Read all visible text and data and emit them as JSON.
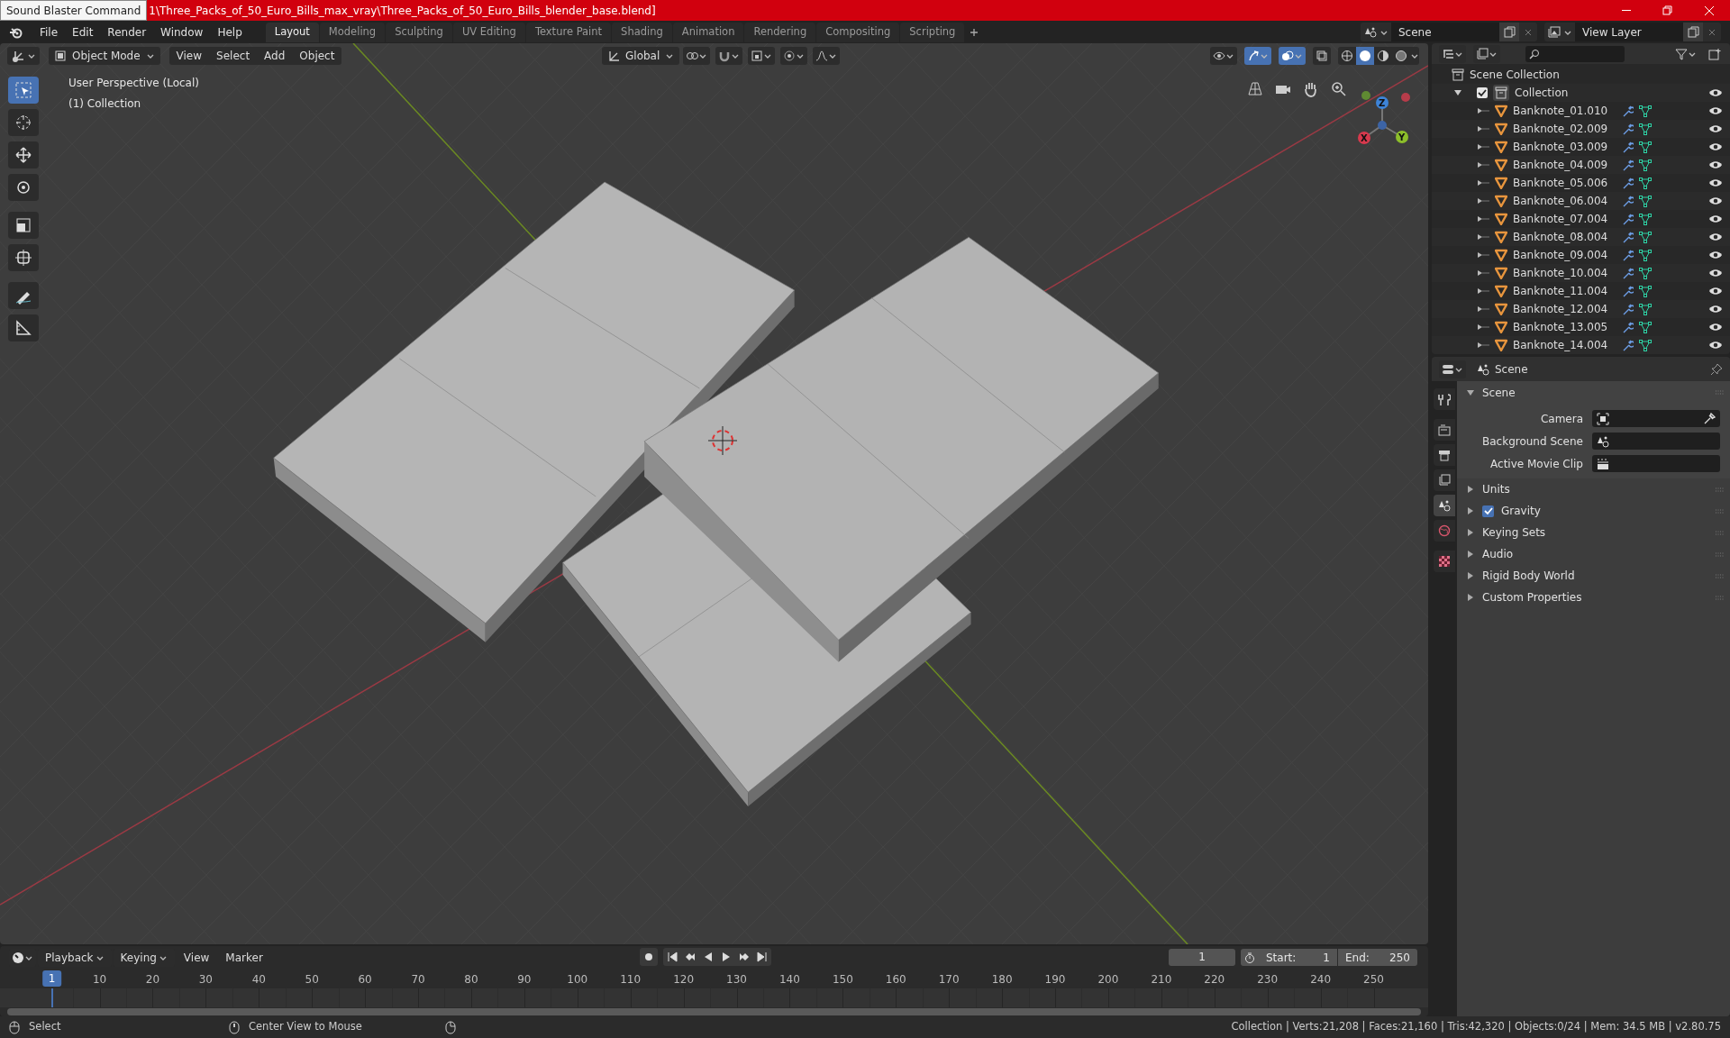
{
  "title_bar": {
    "tooltip": "Sound Blaster Command",
    "title": "1\\Three_Packs_of_50_Euro_Bills_max_vray\\Three_Packs_of_50_Euro_Bills_blender_base.blend]"
  },
  "menu": [
    "File",
    "Edit",
    "Render",
    "Window",
    "Help"
  ],
  "workspaces": [
    {
      "label": "Layout",
      "selected": true
    },
    {
      "label": "Modeling",
      "selected": false
    },
    {
      "label": "Sculpting",
      "selected": false
    },
    {
      "label": "UV Editing",
      "selected": false
    },
    {
      "label": "Texture Paint",
      "selected": false
    },
    {
      "label": "Shading",
      "selected": false
    },
    {
      "label": "Animation",
      "selected": false
    },
    {
      "label": "Rendering",
      "selected": false
    },
    {
      "label": "Compositing",
      "selected": false
    },
    {
      "label": "Scripting",
      "selected": false
    }
  ],
  "scene_selector": {
    "value": "Scene"
  },
  "view_layer_selector": {
    "value": "View Layer"
  },
  "viewport": {
    "mode": "Object Mode",
    "menus": [
      "View",
      "Select",
      "Add",
      "Object"
    ],
    "orientation": "Global",
    "overlay_text": [
      "User Perspective (Local)",
      "(1) Collection"
    ],
    "tools": [
      {
        "kind": "select",
        "selected": true
      },
      {
        "kind": "cursor",
        "selected": false
      },
      {
        "kind": "move",
        "selected": false
      },
      {
        "kind": "rotate",
        "selected": false
      },
      {
        "kind": "scale",
        "selected": false
      },
      {
        "kind": "transform",
        "selected": false
      },
      {
        "kind": "annotate",
        "selected": false
      },
      {
        "kind": "measure",
        "selected": false
      }
    ],
    "gizmo_axes": [
      "X",
      "Y",
      "Z"
    ]
  },
  "outliner": {
    "root": "Scene Collection",
    "collection": {
      "label": "Collection",
      "checked": true,
      "expanded": true,
      "children": [
        {
          "label": "Banknote_01.010"
        },
        {
          "label": "Banknote_02.009"
        },
        {
          "label": "Banknote_03.009"
        },
        {
          "label": "Banknote_04.009"
        },
        {
          "label": "Banknote_05.006"
        },
        {
          "label": "Banknote_06.004"
        },
        {
          "label": "Banknote_07.004"
        },
        {
          "label": "Banknote_08.004"
        },
        {
          "label": "Banknote_09.004"
        },
        {
          "label": "Banknote_10.004"
        },
        {
          "label": "Banknote_11.004"
        },
        {
          "label": "Banknote_12.004"
        },
        {
          "label": "Banknote_13.005"
        },
        {
          "label": "Banknote_14.004"
        }
      ]
    }
  },
  "properties": {
    "header": "Scene",
    "tabs": [
      {
        "kind": "tool",
        "selected": false
      },
      {
        "kind": "render",
        "selected": false
      },
      {
        "kind": "output",
        "selected": false
      },
      {
        "kind": "view_layer",
        "selected": false
      },
      {
        "kind": "scene",
        "selected": true
      },
      {
        "kind": "world",
        "selected": false
      },
      {
        "kind": "texture",
        "selected": false
      }
    ],
    "scene_panel": {
      "label": "Scene",
      "expanded": true,
      "fields": [
        {
          "label": "Camera",
          "kind": "camera"
        },
        {
          "label": "Background Scene",
          "kind": "scene"
        },
        {
          "label": "Active Movie Clip",
          "kind": "clip"
        }
      ]
    },
    "panels": [
      {
        "label": "Units",
        "kind": "plain"
      },
      {
        "label": "Gravity",
        "kind": "checkbox",
        "checked": true
      },
      {
        "label": "Keying Sets",
        "kind": "plain"
      },
      {
        "label": "Audio",
        "kind": "plain"
      },
      {
        "label": "Rigid Body World",
        "kind": "plain"
      },
      {
        "label": "Custom Properties",
        "kind": "plain"
      }
    ]
  },
  "timeline": {
    "menus": [
      "Playback",
      "Keying",
      "View",
      "Marker"
    ],
    "current_frame": "1",
    "start_label": "Start:",
    "start": "1",
    "end_label": "End:",
    "end": "250",
    "playhead": "1",
    "ticks": [
      "10",
      "20",
      "30",
      "40",
      "50",
      "60",
      "70",
      "80",
      "90",
      "100",
      "110",
      "120",
      "130",
      "140",
      "150",
      "160",
      "170",
      "180",
      "190",
      "200",
      "210",
      "220",
      "230",
      "240",
      "250"
    ]
  },
  "status_bar": {
    "hints": [
      "Select",
      "Center View to Mouse"
    ],
    "stats": "Collection | Verts:21,208 | Faces:21,160 | Tris:42,320 | Objects:0/24 | Mem: 34.5 MB | v2.80.75"
  }
}
